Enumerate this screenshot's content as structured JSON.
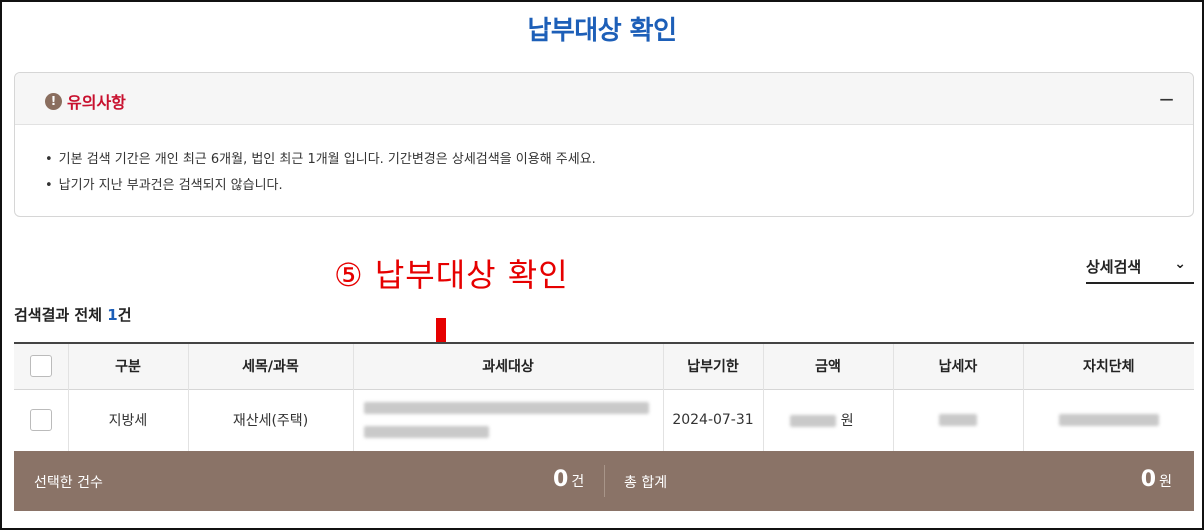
{
  "page": {
    "title": "납부대상 확인"
  },
  "notice": {
    "title": "유의사항",
    "icon": "exclamation-icon",
    "collapse_symbol": "−",
    "items": [
      "기본 검색 기간은 개인 최근 6개월, 법인 최근 1개월 입니다. 기간변경은 상세검색을 이용해 주세요.",
      "납기가 지난 부과건은 검색되지 않습니다."
    ]
  },
  "annotation": {
    "text": "⑤ 납부대상 확인",
    "color": "#e60000"
  },
  "detail_search": {
    "label": "상세검색",
    "chevron": "⌄"
  },
  "results": {
    "prefix": "검색결과 전체 ",
    "count": "1",
    "suffix": "건"
  },
  "table": {
    "headers": [
      "구분",
      "세목/과목",
      "과세대상",
      "납부기한",
      "금액",
      "납세자",
      "자치단체"
    ],
    "rows": [
      {
        "category": "지방세",
        "tax_item": "재산세(주택)",
        "target": "",
        "due_date": "2024-07-31",
        "amount_unit": "원",
        "taxpayer": "",
        "local_gov": ""
      }
    ]
  },
  "footer": {
    "selected_label": "선택한 건수",
    "selected_count": "0",
    "count_unit": "건",
    "total_label": "총 합계",
    "total_amount": "0",
    "amount_unit": "원"
  },
  "colors": {
    "accent": "#1d5fb8",
    "warning": "#c8102e",
    "footer_bg": "#8a7367"
  }
}
